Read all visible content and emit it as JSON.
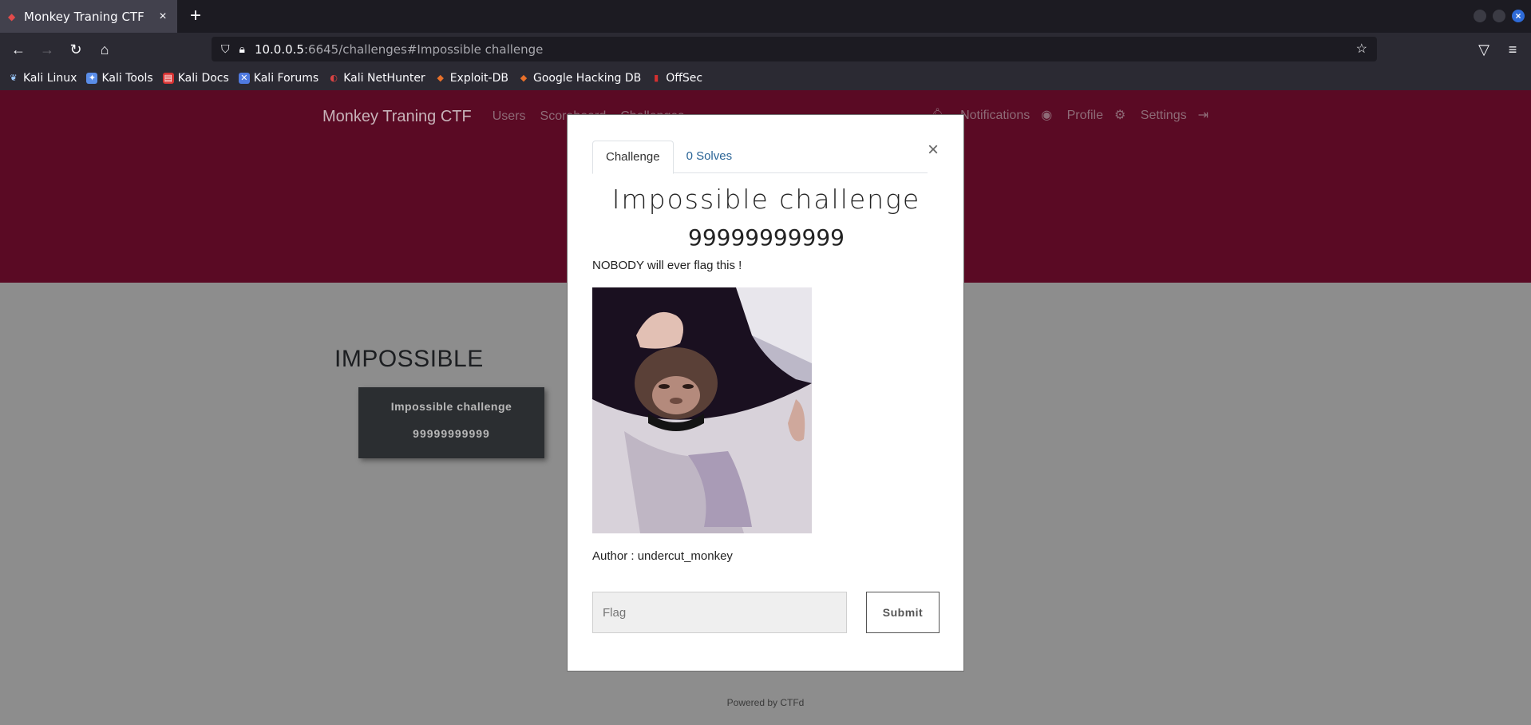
{
  "browser": {
    "tab_title": "Monkey Traning CTF",
    "tab_close": "×",
    "new_tab": "+",
    "url_host": "10.0.0.5",
    "url_rest": ":6645/challenges#Impossible challenge",
    "bookmarks": [
      {
        "label": "Kali Linux",
        "icon": "kali-dragon-icon",
        "color": "#9ecbff"
      },
      {
        "label": "Kali Tools",
        "icon": "kali-tools-icon",
        "color": "#5a8de8"
      },
      {
        "label": "Kali Docs",
        "icon": "kali-docs-icon",
        "color": "#d83333"
      },
      {
        "label": "Kali Forums",
        "icon": "kali-forums-icon",
        "color": "#4f7ae0"
      },
      {
        "label": "Kali NetHunter",
        "icon": "nethunter-icon",
        "color": "#d94343"
      },
      {
        "label": "Exploit-DB",
        "icon": "exploitdb-icon",
        "color": "#e8702a"
      },
      {
        "label": "Google Hacking DB",
        "icon": "ghdb-icon",
        "color": "#e8702a"
      },
      {
        "label": "OffSec",
        "icon": "offsec-icon",
        "color": "#d43030"
      }
    ]
  },
  "site": {
    "brand": "Monkey Traning CTF",
    "nav_links": [
      "Users",
      "Scoreboard",
      "Challenges"
    ],
    "right_links": [
      "Notifications",
      "Profile",
      "Settings"
    ],
    "accent": "#5a0a24"
  },
  "category": {
    "title": "IMPOSSIBLE",
    "card_name": "Impossible challenge",
    "card_value": "99999999999"
  },
  "modal": {
    "close": "×",
    "tabs": [
      "Challenge",
      "0 Solves"
    ],
    "title": "Impossible challenge",
    "value": "99999999999",
    "description": "NOBODY will ever flag this !",
    "author": "Author : undercut_monkey",
    "flag_placeholder": "Flag",
    "submit_label": "Submit"
  },
  "footer": "Powered by CTFd"
}
